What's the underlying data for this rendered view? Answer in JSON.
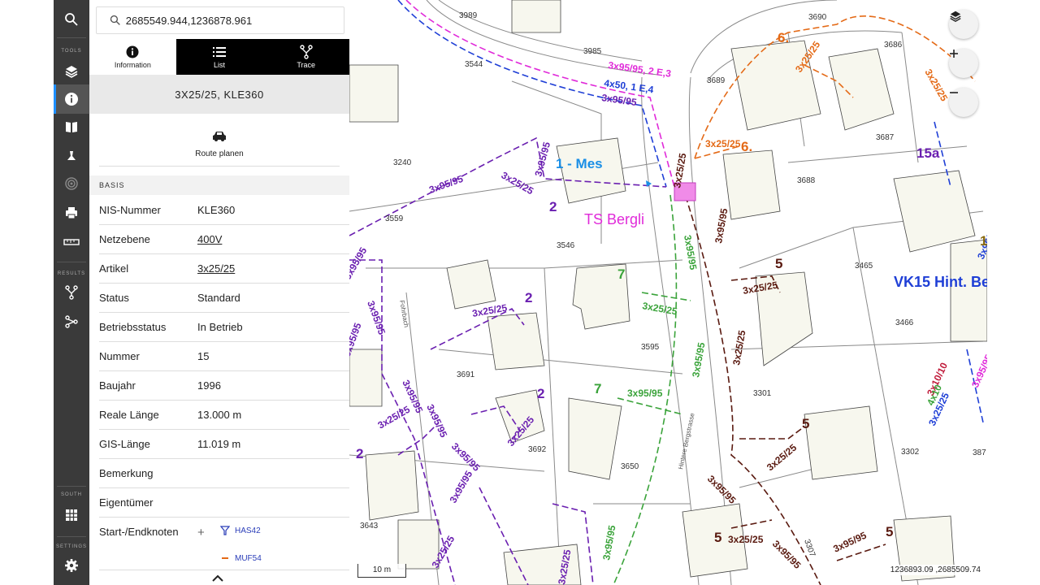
{
  "search": {
    "value": "2685549.944,1236878.961"
  },
  "toolbar": {
    "tools_label": "TOOLS",
    "results_label": "RESULTS",
    "south_label": "SOUTH",
    "settings_label": "SETTINGS"
  },
  "tabs": [
    {
      "label": "Information"
    },
    {
      "label": "List"
    },
    {
      "label": "Trace"
    }
  ],
  "feature": {
    "title": "3X25/25, KLE360",
    "route_label": "Route planen",
    "section": "BASIS"
  },
  "attributes": [
    {
      "key": "NIS-Nummer",
      "value": "KLE360"
    },
    {
      "key": "Netzebene",
      "value": "400V"
    },
    {
      "key": "Artikel",
      "value": "3x25/25"
    },
    {
      "key": "Status",
      "value": "Standard"
    },
    {
      "key": "Betriebsstatus",
      "value": "In Betrieb"
    },
    {
      "key": "Nummer",
      "value": "15"
    },
    {
      "key": "Baujahr",
      "value": "1996"
    },
    {
      "key": "Reale Länge",
      "value": "13.000 m"
    },
    {
      "key": "GIS-Länge",
      "value": "11.019 m"
    },
    {
      "key": "Bemerkung",
      "value": ""
    },
    {
      "key": "Eigentümer",
      "value": ""
    }
  ],
  "nodes": {
    "label": "Start-/Endknoten",
    "start": "HAS42",
    "end": "MUF54"
  },
  "map": {
    "scale_label": "10 m",
    "coords": "1236893.09 ,2685509.74",
    "parcels": [
      "3989",
      "3985",
      "3544",
      "3690",
      "3686",
      "3689",
      "3687",
      "3240",
      "3688",
      "3559",
      "3546",
      "3465",
      "3466",
      "3595",
      "3691",
      "3301",
      "3692",
      "3650",
      "3302",
      "387",
      "3643",
      "3307"
    ],
    "cable_labels": {
      "c1": "3x95/95, 2 E,3",
      "c2": "4x50, 1 E,4",
      "c3": "3x95/95",
      "c4": "3x95/95",
      "c5": "3x25/25",
      "c6": "3x95/95",
      "c7": "3x25/25",
      "c8": "3x95/95",
      "c9": "3x95/95",
      "c10": "3x25/25",
      "c11": "3x25/25",
      "c12": "3x25/25",
      "c13": "3x95/95",
      "c14": "3x25/25",
      "c15": "3x95/95",
      "c16": "3x95/95",
      "c17": "3x95/95",
      "c18": "3x95/95",
      "c19": "3x95/95",
      "c20": "3x25/25",
      "c21": "3x25/25",
      "c22": "3x95/95",
      "c23": "3x25/25",
      "c24": "3x25/25",
      "c25": "3x25/25",
      "c26": "3x95/95",
      "c27": "3x95/95",
      "c28": "3x95/95",
      "c29": "3x25/25",
      "c30": "3x25/25",
      "c31": "3x10/10",
      "c32": "4x10",
      "c33": "3x25/25",
      "c34": "3x25/25",
      "c35": "3x95/95",
      "c36": "3x95/95",
      "c37": "3x95/95",
      "c38": "3x95/95",
      "c39": "3x25/25",
      "c40": "3x95/95"
    },
    "numbers": [
      "1 - Mes",
      "2",
      "2",
      "2",
      "2",
      "5",
      "5",
      "5",
      "5",
      "6.",
      "6.",
      "7",
      "7",
      "15a",
      "1"
    ],
    "names": {
      "station": "TS Bergli",
      "vk": "VK15 Hint. Be"
    },
    "streets": {
      "s1": "Hintere Bergstrasse",
      "s2": "Fohrbach"
    },
    "colors": {
      "violet": "#6a1fb0",
      "orange": "#e46a17",
      "green": "#3aa33a",
      "brown": "#5a1a10",
      "magenta": "#e02ad9",
      "blue": "#1f3fd6",
      "cyan": "#1a8fe6"
    }
  }
}
